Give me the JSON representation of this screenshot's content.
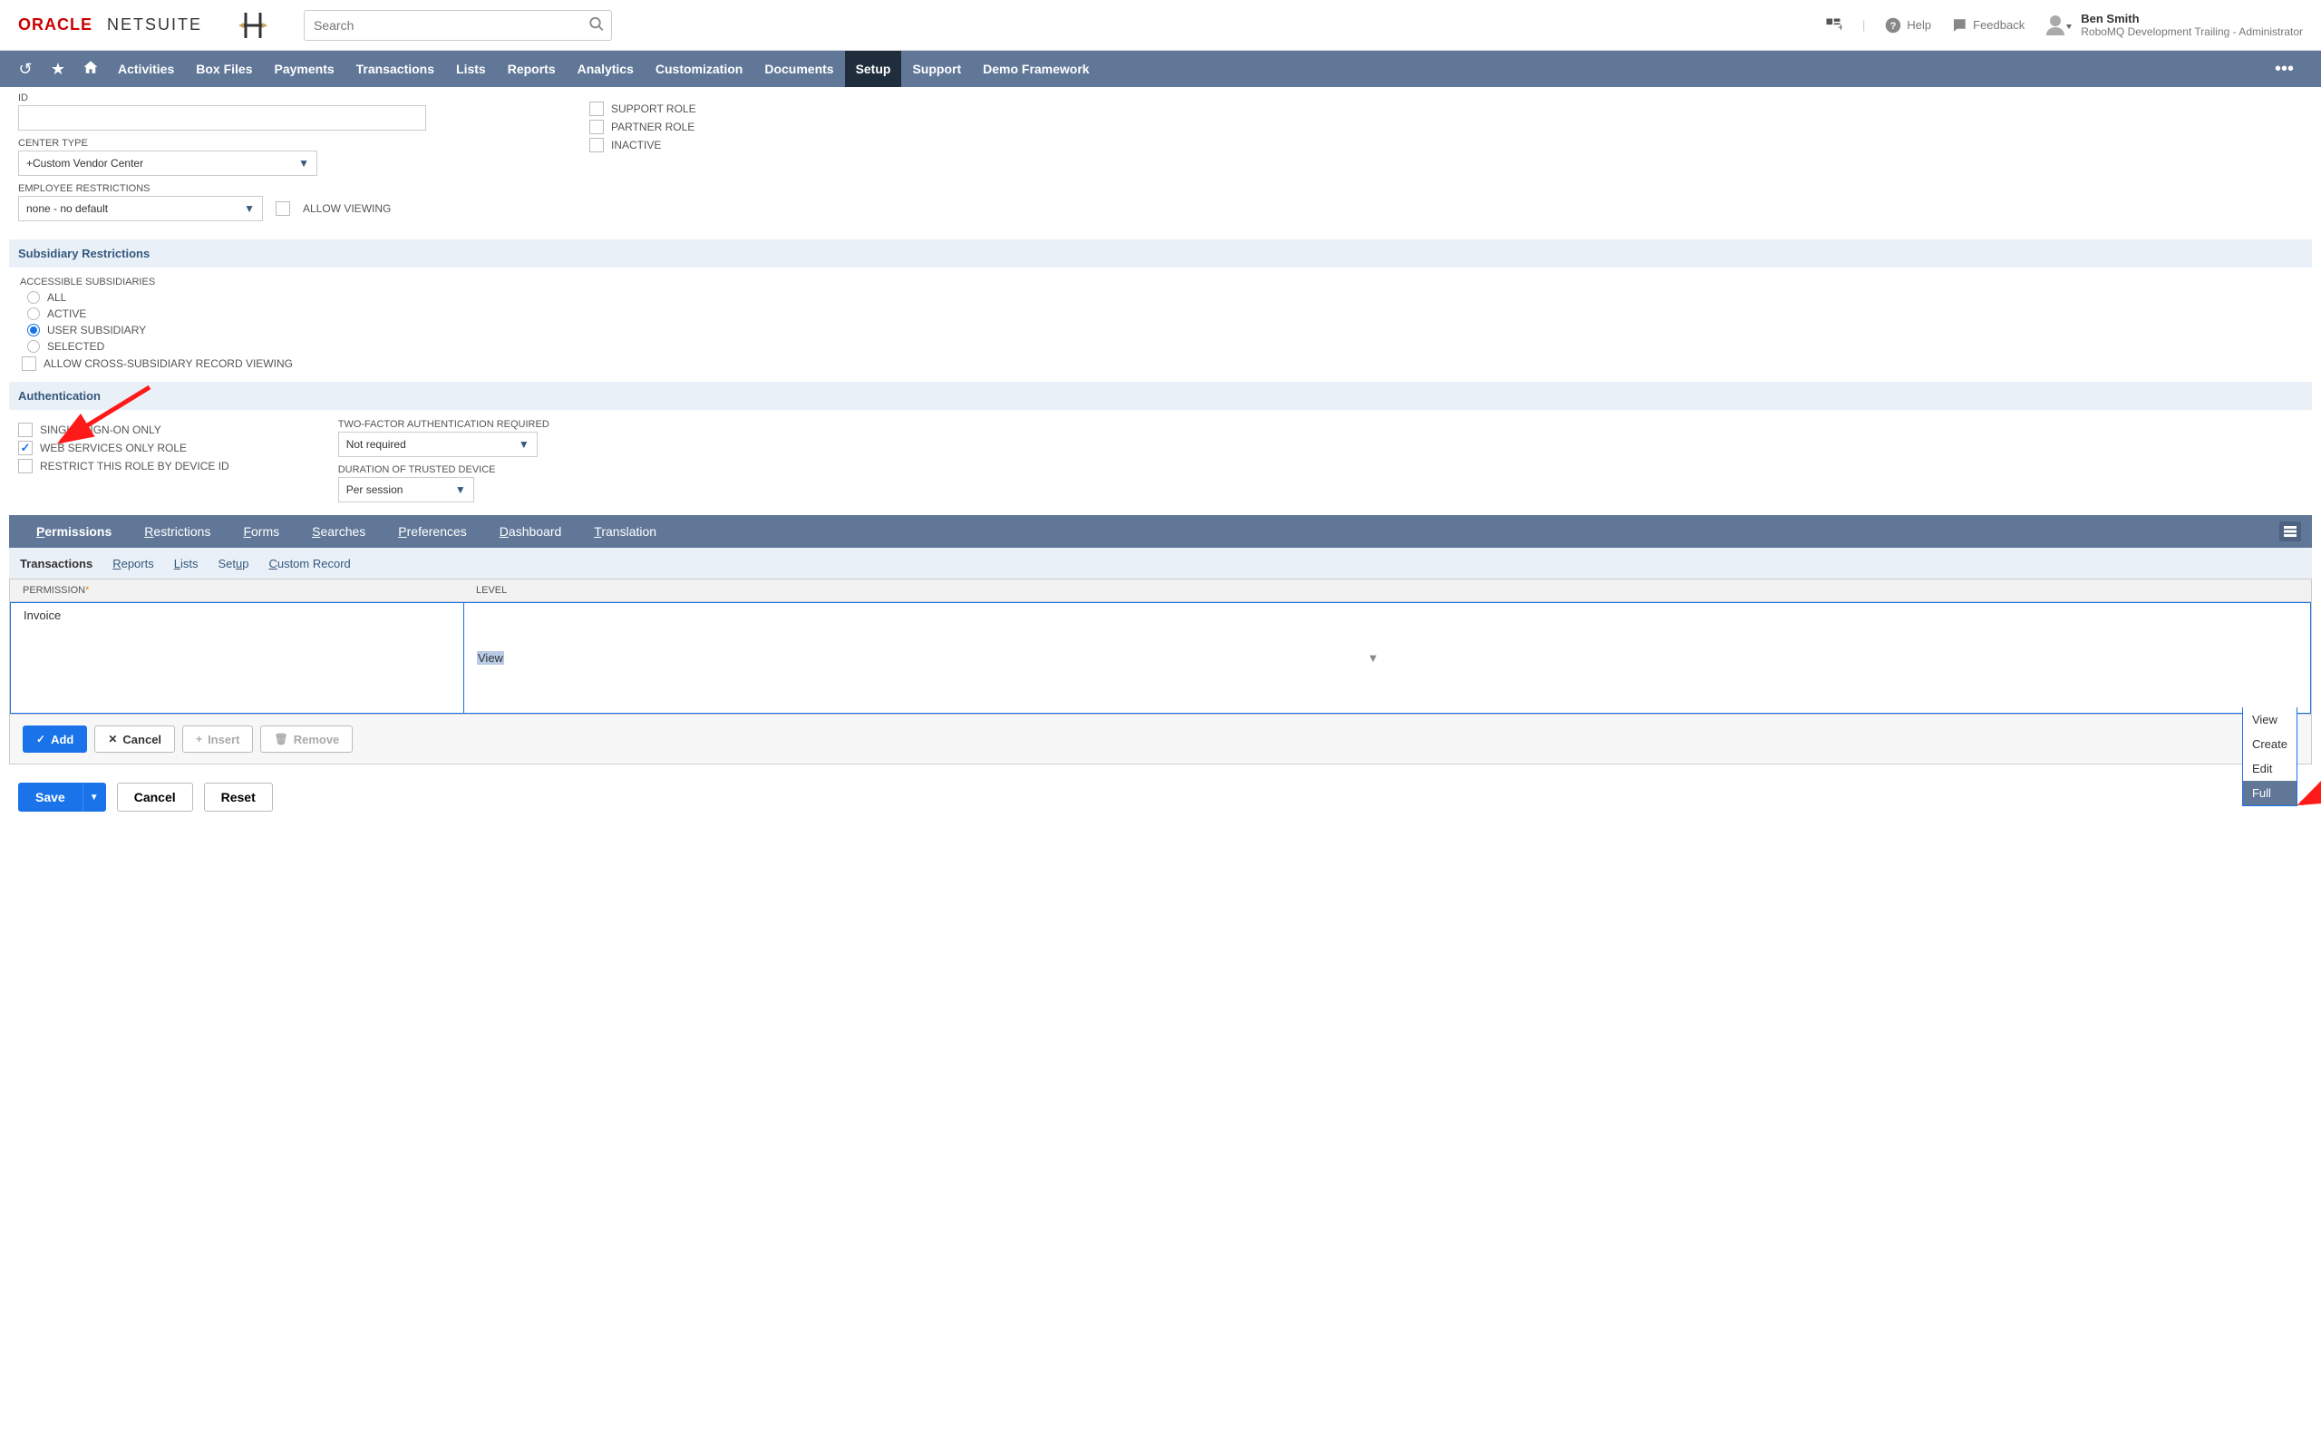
{
  "header": {
    "brand_oracle": "ORACLE",
    "brand_netsuite": "NETSUITE",
    "search_placeholder": "Search",
    "help": "Help",
    "feedback": "Feedback",
    "user_name": "Ben Smith",
    "user_role": "RoboMQ Development Trailing - Administrator"
  },
  "nav": {
    "items": [
      "Activities",
      "Box Files",
      "Payments",
      "Transactions",
      "Lists",
      "Reports",
      "Analytics",
      "Customization",
      "Documents",
      "Setup",
      "Support",
      "Demo Framework"
    ],
    "active": "Setup"
  },
  "form": {
    "id_label": "ID",
    "id_value": "",
    "center_type_label": "CENTER TYPE",
    "center_type_value": "+Custom Vendor Center",
    "emp_restrict_label": "EMPLOYEE RESTRICTIONS",
    "emp_restrict_value": "none - no default",
    "allow_viewing": "ALLOW VIEWING",
    "chk_support_role": "SUPPORT ROLE",
    "chk_partner_role": "PARTNER ROLE",
    "chk_inactive": "INACTIVE"
  },
  "subsidiary": {
    "section": "Subsidiary Restrictions",
    "accessible": "ACCESSIBLE SUBSIDIARIES",
    "all": "ALL",
    "active": "ACTIVE",
    "user": "USER SUBSIDIARY",
    "selected": "SELECTED",
    "allow_cross": "ALLOW CROSS-SUBSIDIARY RECORD VIEWING"
  },
  "auth": {
    "section": "Authentication",
    "sso": "SINGLE SIGN-ON ONLY",
    "ws_only": "WEB SERVICES ONLY ROLE",
    "restrict_device": "RESTRICT THIS ROLE BY DEVICE ID",
    "tfa_label": "TWO-FACTOR AUTHENTICATION REQUIRED",
    "tfa_value": "Not required",
    "duration_label": "DURATION OF TRUSTED DEVICE",
    "duration_value": "Per session"
  },
  "tabs": {
    "items": [
      "Permissions",
      "Restrictions",
      "Forms",
      "Searches",
      "Preferences",
      "Dashboard",
      "Translation"
    ],
    "active": "Permissions"
  },
  "subtabs": {
    "items": [
      "Transactions",
      "Reports",
      "Lists",
      "Setup",
      "Custom Record"
    ],
    "active": "Transactions"
  },
  "perm_table": {
    "head_permission": "PERMISSION",
    "head_level": "LEVEL",
    "row_permission": "Invoice",
    "row_level": "View",
    "options": [
      "View",
      "Create",
      "Edit",
      "Full"
    ],
    "selected_option": "Full"
  },
  "row_buttons": {
    "add": "Add",
    "cancel": "Cancel",
    "insert": "Insert",
    "remove": "Remove"
  },
  "bottom": {
    "save": "Save",
    "cancel": "Cancel",
    "reset": "Reset"
  }
}
